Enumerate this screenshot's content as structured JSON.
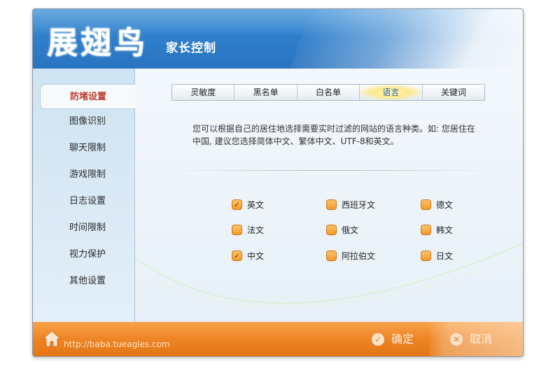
{
  "header": {
    "logo": "展翅鸟",
    "subtitle": "家长控制"
  },
  "sidebar": {
    "items": [
      {
        "label": "防堵设置",
        "active": true
      },
      {
        "label": "图像识别"
      },
      {
        "label": "聊天限制"
      },
      {
        "label": "游戏限制"
      },
      {
        "label": "日志设置"
      },
      {
        "label": "时间限制"
      },
      {
        "label": "视力保护"
      },
      {
        "label": "其他设置"
      }
    ]
  },
  "tabs": [
    {
      "label": "灵敏度"
    },
    {
      "label": "黑名单"
    },
    {
      "label": "白名单"
    },
    {
      "label": "语言",
      "active": true
    },
    {
      "label": "关键词"
    }
  ],
  "main": {
    "description": "您可以根据自己的居住地选择需要实时过滤的网站的语言种类。如: 您居住在中国, 建议您选择简体中文、繁体中文、UTF-8和英文。",
    "languages": [
      {
        "label": "英文",
        "checked": true
      },
      {
        "label": "西班牙文",
        "checked": false
      },
      {
        "label": "德文",
        "checked": false
      },
      {
        "label": "法文",
        "checked": false
      },
      {
        "label": "俄文",
        "checked": false
      },
      {
        "label": "韩文",
        "checked": false
      },
      {
        "label": "中文",
        "checked": true
      },
      {
        "label": "阿拉伯文",
        "checked": false
      },
      {
        "label": "日文",
        "checked": false
      }
    ]
  },
  "footer": {
    "url": "http://baba.tueagles.com",
    "confirm_label": "确定",
    "cancel_label": "取消"
  },
  "colors": {
    "header_blue": "#2f7fcc",
    "footer_orange": "#ee8424",
    "active_red": "#c0392b",
    "checkbox_orange": "#f39a2a"
  }
}
